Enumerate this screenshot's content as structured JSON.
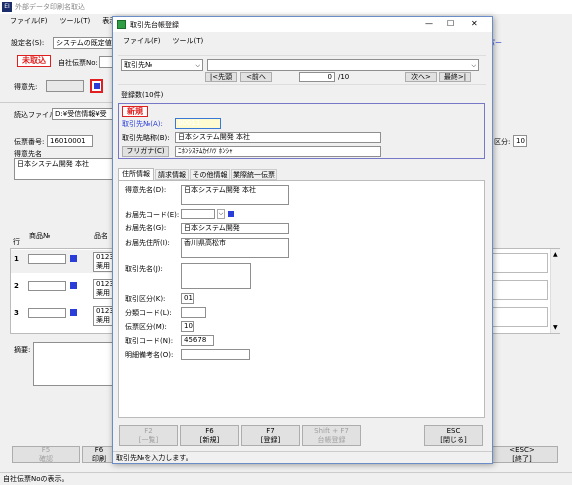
{
  "main": {
    "title": "外部データ印刷名取込",
    "menu": [
      "ファイル(F)",
      "ツール(T)",
      "表示(V)"
    ],
    "setting_label": "設定名(S):",
    "setting_value": "システムの既定値",
    "badge": "未取込",
    "company_label": "自社伝票No:",
    "customer_label": "得意先:",
    "file_label": "読込ファイル名:",
    "file_value": "D:¥受信情報¥受",
    "slip_no_label": "伝票番号:",
    "slip_no_value": "16010001",
    "customer_name_label": "得意先名",
    "customer_name_value": "日本システム開発 本社",
    "right_link": "パー",
    "right_field_label": "区分:",
    "right_field_value": "10",
    "product_header": "商品№",
    "product_name_header": "品名",
    "row_header": "行",
    "rows": [
      {
        "no": "1",
        "line1": "01234",
        "line2": "薬用"
      },
      {
        "no": "2",
        "line1": "01234",
        "line2": "薬用"
      },
      {
        "no": "3",
        "line1": "01234",
        "line2": "薬用"
      }
    ],
    "memo_label": "摘要:",
    "footer_buttons": [
      {
        "key": "F5",
        "label": "確認",
        "dim": true
      },
      {
        "key": "F6",
        "label": "印刷",
        "dim": false
      }
    ],
    "end_key": "<ESC>",
    "end_label": "[終了]",
    "status": "自社伝票Noの表示。"
  },
  "dialog": {
    "title": "取引先台帳登録",
    "menu": [
      "ファイル(F)",
      "ツール(T)"
    ],
    "search_select": "取引先№",
    "nav_first": "|<先頭",
    "nav_prev": "<前へ",
    "nav_page": "0",
    "nav_total": "/10",
    "nav_next": "次へ>",
    "nav_last": "最終>|",
    "count_label": "登録数(10件)",
    "badge_new": "新規",
    "code_label": "取引先№(A):",
    "code_value": "00011",
    "shortname_label": "取引先略称(B):",
    "shortname_value": "日本システム開発 本社",
    "furigana_label": "フリガナ(C)",
    "furigana_value": "ﾆﾎﾝｼｽﾃﾑｶｲﾊﾂ ﾎﾝｼｬ",
    "tabs": [
      "住所情報",
      "請求情報",
      "その他情報",
      "業際統一伝票"
    ],
    "customer_name_label": "得意先名(D):",
    "customer_name_value": "日本システム開発 本社",
    "dest_code_label": "お届先コード(E):",
    "dest_name_label": "お届先名(G):",
    "dest_name_value": "日本システム開発",
    "dest_addr_label": "お届先住所(I):",
    "dest_addr_value": "香川県高松市",
    "trade_name_label": "取引先名(J):",
    "trade_cat_label": "取引区分(K):",
    "trade_cat_value": "01",
    "class_code_label": "分類コード(L):",
    "slip_cat_label": "伝票区分(M):",
    "slip_cat_value": "10",
    "trade_code_label": "取引コード(N):",
    "trade_code_value": "45678",
    "detail_label": "明細備考名(O):",
    "buttons": [
      {
        "key": "F2",
        "label": "[一覧]",
        "dim": true
      },
      {
        "key": "F6",
        "label": "[新規]",
        "dim": false
      },
      {
        "key": "F7",
        "label": "[登録]",
        "dim": false
      },
      {
        "key": "Shift + F7",
        "label": "台帳登録",
        "dim": true
      },
      {
        "key": "ESC",
        "label": "[閉じる]",
        "dim": false
      }
    ],
    "status": "取引先№を入力します。"
  },
  "colors": {
    "accent": "#2a3dd8",
    "badge_red": "#e02020",
    "highlight": "#3a78d8"
  }
}
